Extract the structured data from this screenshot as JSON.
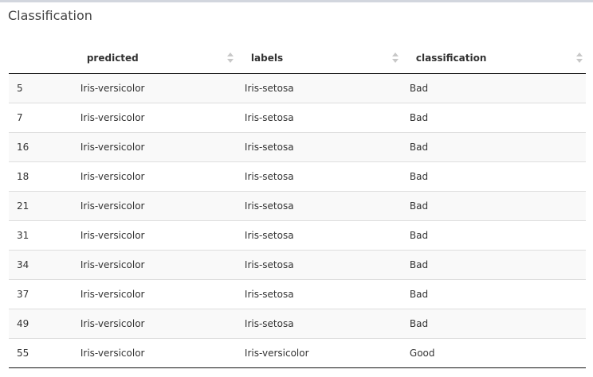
{
  "box": {
    "title": "Classification"
  },
  "table": {
    "headers": [
      "",
      "predicted",
      "labels",
      "classification"
    ],
    "rows": [
      {
        "id": "5",
        "predicted": "Iris-versicolor",
        "labels": "Iris-setosa",
        "classification": "Bad"
      },
      {
        "id": "7",
        "predicted": "Iris-versicolor",
        "labels": "Iris-setosa",
        "classification": "Bad"
      },
      {
        "id": "16",
        "predicted": "Iris-versicolor",
        "labels": "Iris-setosa",
        "classification": "Bad"
      },
      {
        "id": "18",
        "predicted": "Iris-versicolor",
        "labels": "Iris-setosa",
        "classification": "Bad"
      },
      {
        "id": "21",
        "predicted": "Iris-versicolor",
        "labels": "Iris-setosa",
        "classification": "Bad"
      },
      {
        "id": "31",
        "predicted": "Iris-versicolor",
        "labels": "Iris-setosa",
        "classification": "Bad"
      },
      {
        "id": "34",
        "predicted": "Iris-versicolor",
        "labels": "Iris-setosa",
        "classification": "Bad"
      },
      {
        "id": "37",
        "predicted": "Iris-versicolor",
        "labels": "Iris-setosa",
        "classification": "Bad"
      },
      {
        "id": "49",
        "predicted": "Iris-versicolor",
        "labels": "Iris-setosa",
        "classification": "Bad"
      },
      {
        "id": "55",
        "predicted": "Iris-versicolor",
        "labels": "Iris-versicolor",
        "classification": "Good"
      }
    ]
  },
  "icons": {
    "sort": "sort-both-icon"
  },
  "colors": {
    "top_border": "#d2d6de",
    "striped_row": "#f9f9f9",
    "sort_arrow": "#c8c8c8"
  }
}
